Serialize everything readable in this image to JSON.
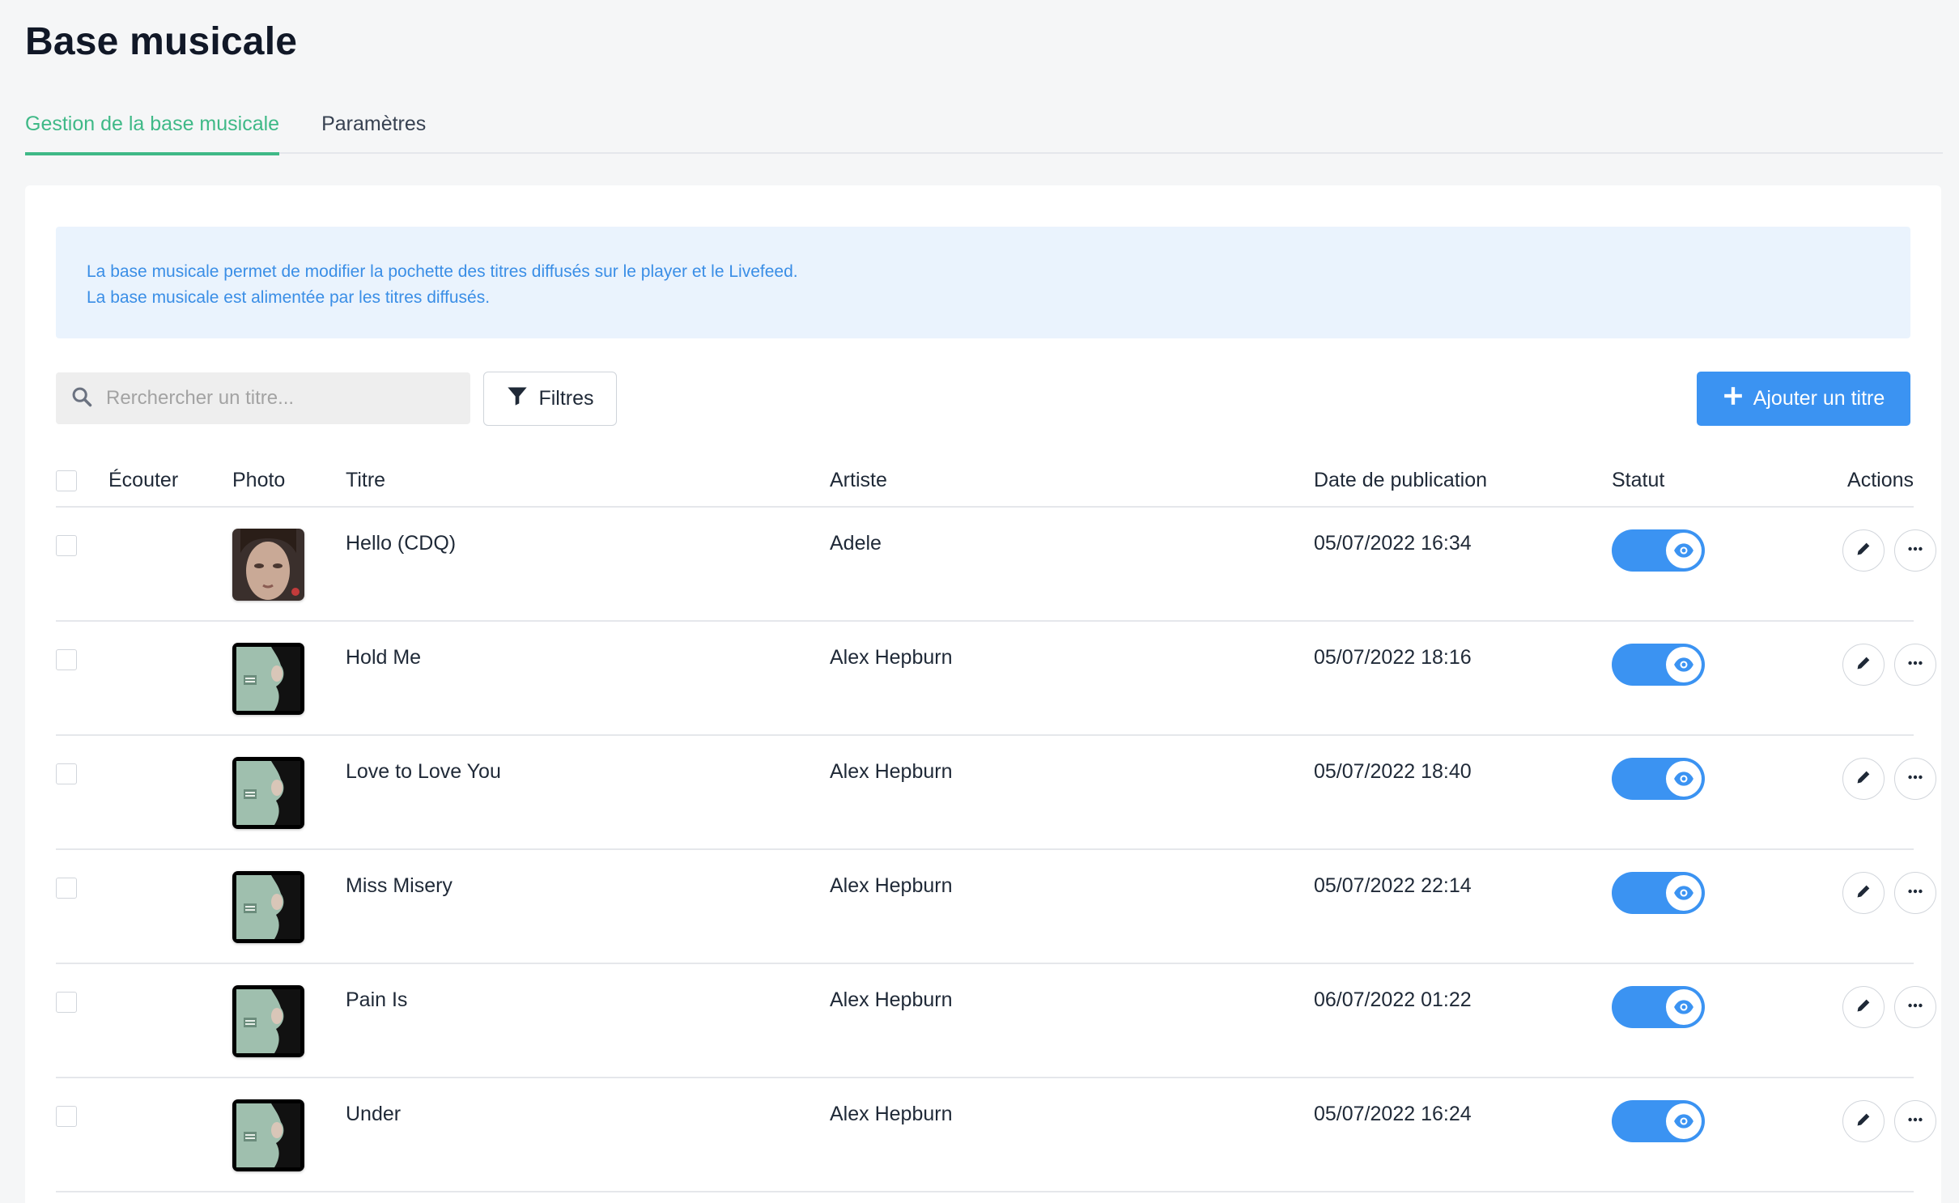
{
  "page": {
    "title": "Base musicale"
  },
  "tabs": [
    {
      "label": "Gestion de la base musicale",
      "active": true
    },
    {
      "label": "Paramètres",
      "active": false
    }
  ],
  "info": {
    "line1": "La base musicale permet de modifier la pochette des titres diffusés sur le player et le Livefeed.",
    "line2": "La base musicale est alimentée par les titres diffusés."
  },
  "toolbar": {
    "search_placeholder": "Rerchercher un titre...",
    "search_icon": "search-icon",
    "filters_label": "Filtres",
    "filters_icon": "filter-icon",
    "add_label": "Ajouter un titre",
    "add_icon": "plus-icon"
  },
  "table": {
    "columns": {
      "listen": "Écouter",
      "photo": "Photo",
      "title": "Titre",
      "artist": "Artiste",
      "date": "Date de publication",
      "status": "Statut",
      "actions": "Actions"
    },
    "rows": [
      {
        "title": "Hello (CDQ)",
        "artist": "Adele",
        "date": "05/07/2022 16:34",
        "cover": "adele-cover",
        "visible": true
      },
      {
        "title": "Hold Me",
        "artist": "Alex Hepburn",
        "date": "05/07/2022 18:16",
        "cover": "alex-hepburn-cover",
        "visible": true
      },
      {
        "title": "Love to Love You",
        "artist": "Alex Hepburn",
        "date": "05/07/2022 18:40",
        "cover": "alex-hepburn-cover",
        "visible": true
      },
      {
        "title": "Miss Misery",
        "artist": "Alex Hepburn",
        "date": "05/07/2022 22:14",
        "cover": "alex-hepburn-cover",
        "visible": true
      },
      {
        "title": "Pain Is",
        "artist": "Alex Hepburn",
        "date": "06/07/2022 01:22",
        "cover": "alex-hepburn-cover",
        "visible": true
      },
      {
        "title": "Under",
        "artist": "Alex Hepburn",
        "date": "05/07/2022 16:24",
        "cover": "alex-hepburn-cover",
        "visible": true
      }
    ]
  },
  "colors": {
    "accent_green": "#3fb987",
    "primary_blue": "#3b93f2",
    "info_bg": "#eaf3fd",
    "info_text": "#3a8ee6"
  }
}
